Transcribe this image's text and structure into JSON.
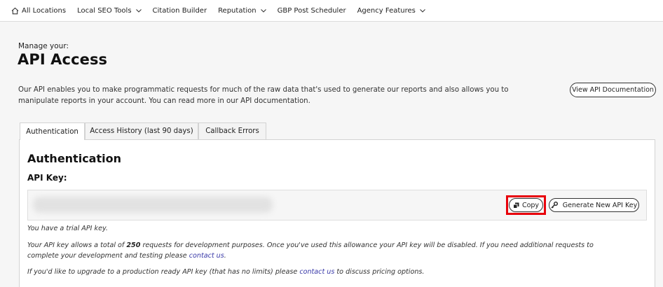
{
  "nav": {
    "items": [
      {
        "label": "All Locations",
        "icon": "home-icon",
        "dropdown": false
      },
      {
        "label": "Local SEO Tools",
        "dropdown": true
      },
      {
        "label": "Citation Builder",
        "dropdown": false
      },
      {
        "label": "Reputation",
        "dropdown": true
      },
      {
        "label": "GBP Post Scheduler",
        "dropdown": false
      },
      {
        "label": "Agency Features",
        "dropdown": true
      }
    ]
  },
  "header": {
    "subtitle": "Manage your:",
    "title": "API Access",
    "intro": "Our API enables you to make programmatic requests for much of the raw data that's used to generate our reports and also allows you to manipulate reports in your account. You can read more in our API documentation.",
    "doc_button": "View API Documentation"
  },
  "tabs": [
    {
      "label": "Authentication",
      "active": true
    },
    {
      "label": "Access History (last 90 days)",
      "active": false
    },
    {
      "label": "Callback Errors",
      "active": false
    }
  ],
  "auth": {
    "title": "Authentication",
    "key_label": "API Key:",
    "copy_button": "Copy",
    "generate_button": "Generate New API Key",
    "trial_note": "You have a trial API key.",
    "allowance": {
      "before": "Your API key allows a total of ",
      "count": "250",
      "after": " requests for development purposes. Once you've used this allowance your API key will be disabled. If you need additional requests to complete your development and testing please ",
      "link": "contact us",
      "end": "."
    },
    "upgrade": {
      "before": "If you'd like to upgrade to a production ready API key (that has no limits) please ",
      "link": "contact us",
      "after": " to discuss pricing options."
    }
  },
  "colors": {
    "highlight": "#e8000b",
    "link": "#3a3aa8"
  }
}
